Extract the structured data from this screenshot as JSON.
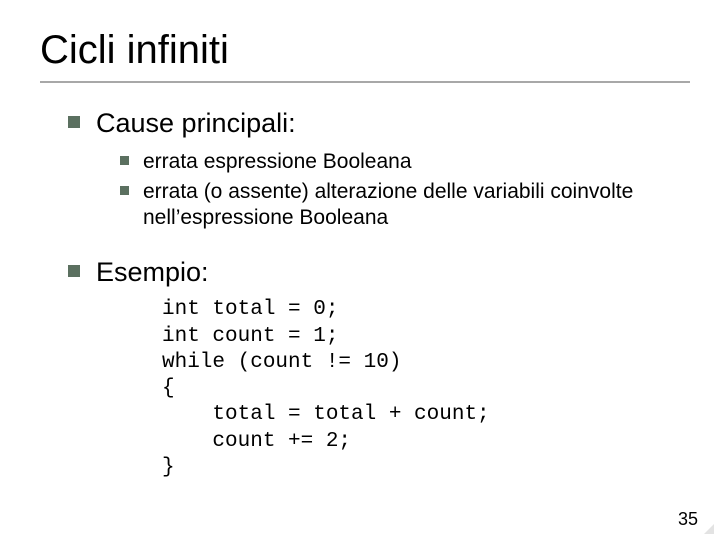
{
  "title": "Cicli infiniti",
  "bullets": {
    "b1": "Cause principali:",
    "b1a": "errata espressione Booleana",
    "b1b": "errata (o assente) alterazione delle variabili coinvolte nell’espressione Booleana",
    "b2": "Esempio:"
  },
  "code": "int total = 0;\nint count = 1;\nwhile (count != 10)\n{\n    total = total + count;\n    count += 2;\n}",
  "page_number": "35",
  "chart_data": null
}
